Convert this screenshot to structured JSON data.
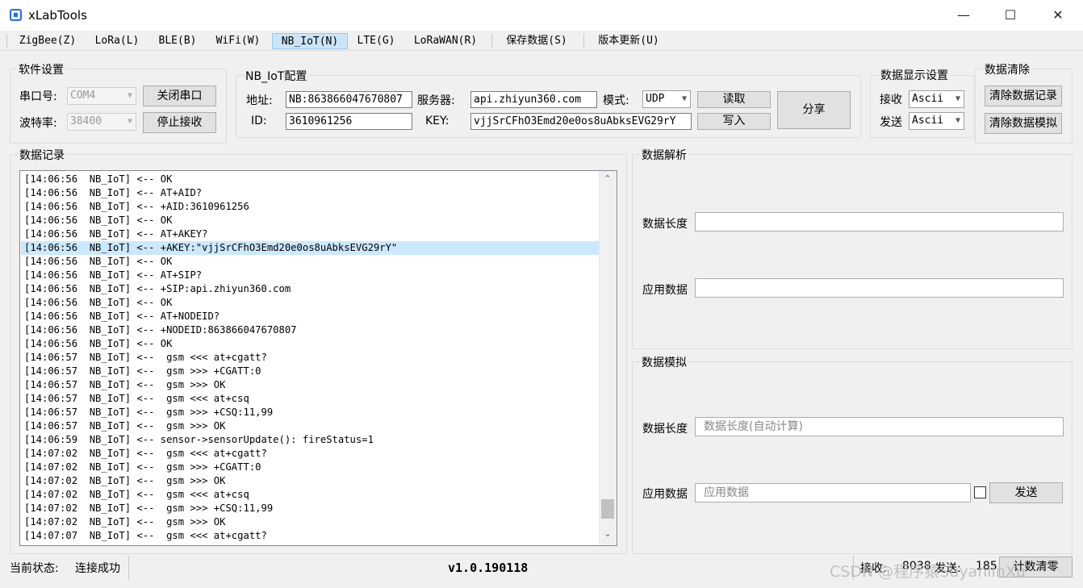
{
  "window": {
    "title": "xLabTools",
    "controls": {
      "minimize": "—",
      "maximize": "☐",
      "close": "✕"
    }
  },
  "menu": [
    "ZigBee(Z)",
    "LoRa(L)",
    "BLE(B)",
    "WiFi(W)",
    "NB_IoT(N)",
    "LTE(G)",
    "LoRaWAN(R)",
    "保存数据(S)",
    "版本更新(U)"
  ],
  "software_settings": {
    "title": "软件设置",
    "port_label": "串口号:",
    "port_value": "COM4",
    "baud_label": "波特率:",
    "baud_value": "38400",
    "close_port_button": "关闭串口",
    "stop_receive_button": "停止接收"
  },
  "nbiot_config": {
    "title": "NB_IoT配置",
    "address_label": "地址:",
    "address_value": "NB:863866047670807",
    "id_label": "ID:",
    "id_value": "3610961256",
    "server_label": "服务器:",
    "server_value": "api.zhiyun360.com",
    "key_label": "KEY:",
    "key_value": "vjjSrCFhO3Emd20e0os8uAbksEVG29rY",
    "mode_label": "模式:",
    "mode_value": "UDP",
    "read_button": "读取",
    "write_button": "写入",
    "share_button": "分享"
  },
  "display_settings": {
    "title": "数据显示设置",
    "receive_label": "接收",
    "receive_value": "Ascii",
    "send_label": "发送",
    "send_value": "Ascii"
  },
  "data_clear": {
    "title": "数据清除",
    "clear_records_button": "清除数据记录",
    "clear_simulation_button": "清除数据模拟"
  },
  "data_log": {
    "title": "数据记录",
    "lines": [
      "[14:06:56  NB_IoT] <-- OK",
      "[14:06:56  NB_IoT] <-- AT+AID?",
      "[14:06:56  NB_IoT] <-- +AID:3610961256",
      "[14:06:56  NB_IoT] <-- OK",
      "[14:06:56  NB_IoT] <-- AT+AKEY?",
      "[14:06:56  NB_IoT] <-- +AKEY:\"vjjSrCFhO3Emd20e0os8uAbksEVG29rY\"",
      "[14:06:56  NB_IoT] <-- OK",
      "[14:06:56  NB_IoT] <-- AT+SIP?",
      "[14:06:56  NB_IoT] <-- +SIP:api.zhiyun360.com",
      "[14:06:56  NB_IoT] <-- OK",
      "[14:06:56  NB_IoT] <-- AT+NODEID?",
      "[14:06:56  NB_IoT] <-- +NODEID:863866047670807",
      "[14:06:56  NB_IoT] <-- OK",
      "[14:06:57  NB_IoT] <--  gsm <<< at+cgatt?",
      "[14:06:57  NB_IoT] <--  gsm >>> +CGATT:0",
      "[14:06:57  NB_IoT] <--  gsm >>> OK",
      "[14:06:57  NB_IoT] <--  gsm <<< at+csq",
      "[14:06:57  NB_IoT] <--  gsm >>> +CSQ:11,99",
      "[14:06:57  NB_IoT] <--  gsm >>> OK",
      "[14:06:59  NB_IoT] <-- sensor->sensorUpdate(): fireStatus=1",
      "[14:07:02  NB_IoT] <--  gsm <<< at+cgatt?",
      "[14:07:02  NB_IoT] <--  gsm >>> +CGATT:0",
      "[14:07:02  NB_IoT] <--  gsm >>> OK",
      "[14:07:02  NB_IoT] <--  gsm <<< at+csq",
      "[14:07:02  NB_IoT] <--  gsm >>> +CSQ:11,99",
      "[14:07:02  NB_IoT] <--  gsm >>> OK",
      "[14:07:07  NB_IoT] <--  gsm <<< at+cgatt?"
    ],
    "selected_line": 5
  },
  "data_parse": {
    "title": "数据解析",
    "length_label": "数据长度",
    "length_value": "",
    "app_data_label": "应用数据",
    "app_data_value": ""
  },
  "data_simulation": {
    "title": "数据模拟",
    "length_label": "数据长度",
    "length_placeholder": "数据长度(自动计算)",
    "app_data_label": "应用数据",
    "app_data_placeholder": "应用数据",
    "send_button": "发送"
  },
  "status_bar": {
    "state_label": "当前状态:",
    "state_value": "连接成功",
    "version": "v1.0.190118",
    "receive_label": "接收:",
    "receive_count": "8038",
    "send_label": "发送:",
    "send_count": "185",
    "reset_button": "计数清零"
  },
  "watermark": "CSDN @程序猿SuyanlinXu"
}
